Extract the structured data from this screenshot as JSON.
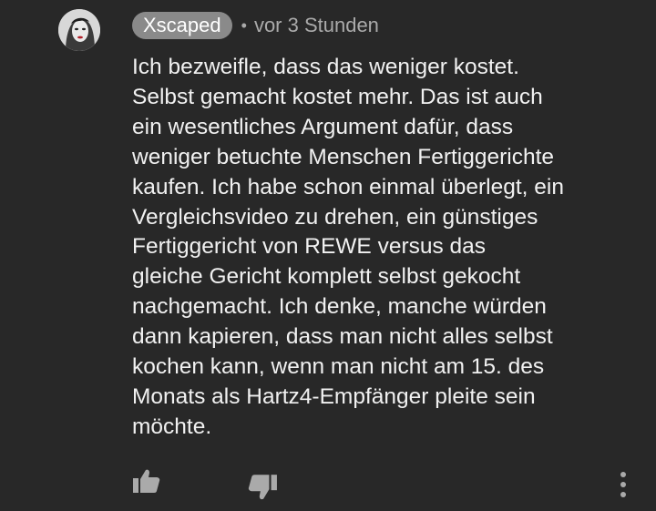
{
  "comment": {
    "author": "Xscaped",
    "separator": "•",
    "timestamp": "vor 3 Stunden",
    "text": "Ich bezweifle, dass das weniger kostet.\nSelbst gemacht kostet mehr. Das ist auch\nein wesentliches Argument dafür, dass\nweniger betuchte Menschen Fertiggerichte\nkaufen. Ich habe schon einmal überlegt, ein\nVergleichsvideo zu drehen, ein günstiges\nFertiggericht von REWE versus das\ngleiche Gericht komplett selbst gekocht\nnachgemacht. Ich denke, manche würden\ndann kapieren, dass man nicht alles selbst\nkochen kann, wenn man nicht am 15. des\nMonats als Hartz4-Empfänger pleite sein\nmöchte."
  },
  "icons": {
    "like": "thumbs-up-icon",
    "dislike": "thumbs-down-icon",
    "more": "more-vert-icon"
  },
  "colors": {
    "background": "#282828",
    "text": "#f1f1f1",
    "secondary_text": "#aaaaaa",
    "author_chip": "#8a8a8a"
  }
}
